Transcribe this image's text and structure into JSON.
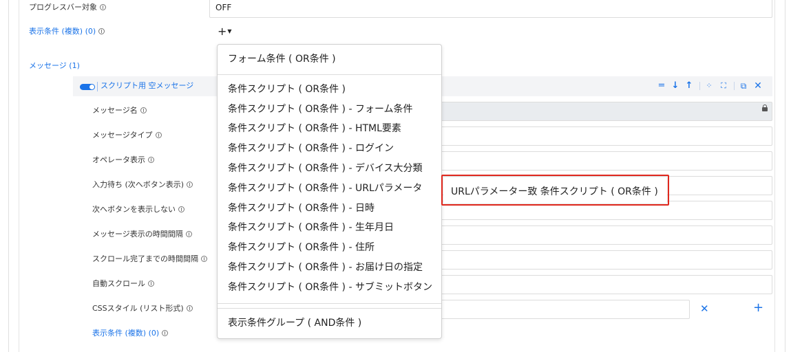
{
  "form": {
    "progress_bar_label": "プログレスバー対象",
    "progress_bar_value": "OFF",
    "display_conditions_label": "表示条件 (複数) (0)",
    "messages_label": "メッセージ (1)"
  },
  "message": {
    "title": "スクリプト用 空メッセージ",
    "fields": {
      "name": "メッセージ名",
      "type": "メッセージタイプ",
      "operator_display": "オペレータ表示",
      "wait_input": "入力待ち (次へボタン表示)",
      "hide_next_button": "次へボタンを表示しない",
      "display_interval": "メッセージ表示の時間間隔",
      "scroll_interval": "スクロール完了までの時間間隔",
      "auto_scroll": "自動スクロール",
      "css_style": "CSSスタイル (リスト形式)",
      "display_conditions": "表示条件 (複数) (0)"
    },
    "toolbar_icons": [
      "drag-handle-icon",
      "move-down-icon",
      "move-up-icon",
      "collapse-icon",
      "expand-icon",
      "copy-icon",
      "close-icon"
    ]
  },
  "menu": {
    "form_condition": "フォーム条件 ( OR条件 )",
    "script_items": [
      "条件スクリプト ( OR条件 )",
      "条件スクリプト ( OR条件 ) - フォーム条件",
      "条件スクリプト ( OR条件 ) - HTML要素",
      "条件スクリプト ( OR条件 ) - ログイン",
      "条件スクリプト ( OR条件 ) - デバイス大分類",
      "条件スクリプト ( OR条件 ) - URLパラメータ",
      "条件スクリプト ( OR条件 ) - 日時",
      "条件スクリプト ( OR条件 ) - 生年月日",
      "条件スクリプト ( OR条件 ) - 住所",
      "条件スクリプト ( OR条件 ) - お届け日の指定",
      "条件スクリプト ( OR条件 ) - サブミットボタン"
    ],
    "group_condition": "表示条件グループ ( AND条件 )"
  },
  "submenu": {
    "item": "URLパラメーター致 条件スクリプト ( OR条件 )"
  },
  "colors": {
    "link": "#1a73e8",
    "highlight": "#e0271d"
  }
}
